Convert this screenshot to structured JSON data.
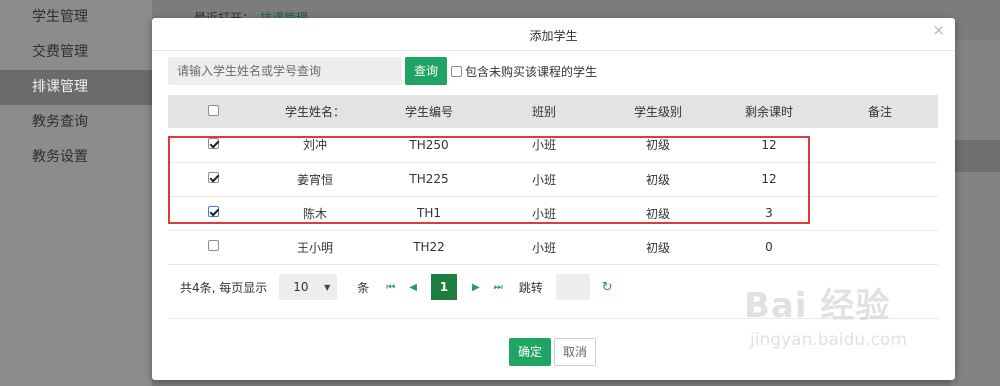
{
  "background": {
    "sidebar": [
      {
        "label": "学生管理",
        "active": false
      },
      {
        "label": "交费管理",
        "active": false
      },
      {
        "label": "排课管理",
        "active": true
      },
      {
        "label": "教务查询",
        "active": false
      },
      {
        "label": "教务设置",
        "active": false
      }
    ],
    "recent_label": "最近打开：",
    "recent_link": "排课管理"
  },
  "modal": {
    "title": "添加学生",
    "close_icon": "close-icon",
    "search_placeholder": "请输入学生姓名或学号查询",
    "query_label": "查询",
    "include_label": "包含未购买该课程的学生",
    "columns": [
      "学生姓名：",
      "学生编号",
      "班别",
      "学生级别",
      "剩余课时",
      "备注"
    ],
    "rows": [
      {
        "checked": true,
        "name": "刘冲",
        "id": "TH250",
        "class": "小班",
        "level": "初级",
        "hours": "12",
        "note": ""
      },
      {
        "checked": true,
        "name": "姜宵恒",
        "id": "TH225",
        "class": "小班",
        "level": "初级",
        "hours": "12",
        "note": ""
      },
      {
        "checked": true,
        "name": "陈木",
        "id": "TH1",
        "class": "小班",
        "level": "初级",
        "hours": "3",
        "note": ""
      },
      {
        "checked": false,
        "name": "王小明",
        "id": "TH22",
        "class": "小班",
        "level": "初级",
        "hours": "0",
        "note": ""
      }
    ],
    "pager": {
      "total_text": "共4条, 每页显示",
      "page_size": "10",
      "unit": "条",
      "current_page": "1",
      "jump_label": "跳转"
    },
    "confirm_label": "确定",
    "cancel_label": "取消"
  },
  "watermark": {
    "main": "Bai 经验",
    "sub": "jingyan.baidu.com"
  },
  "colors": {
    "accent_green": "#1fa463",
    "page_green": "#1f7d3f",
    "highlight_red": "#e03a3a"
  }
}
